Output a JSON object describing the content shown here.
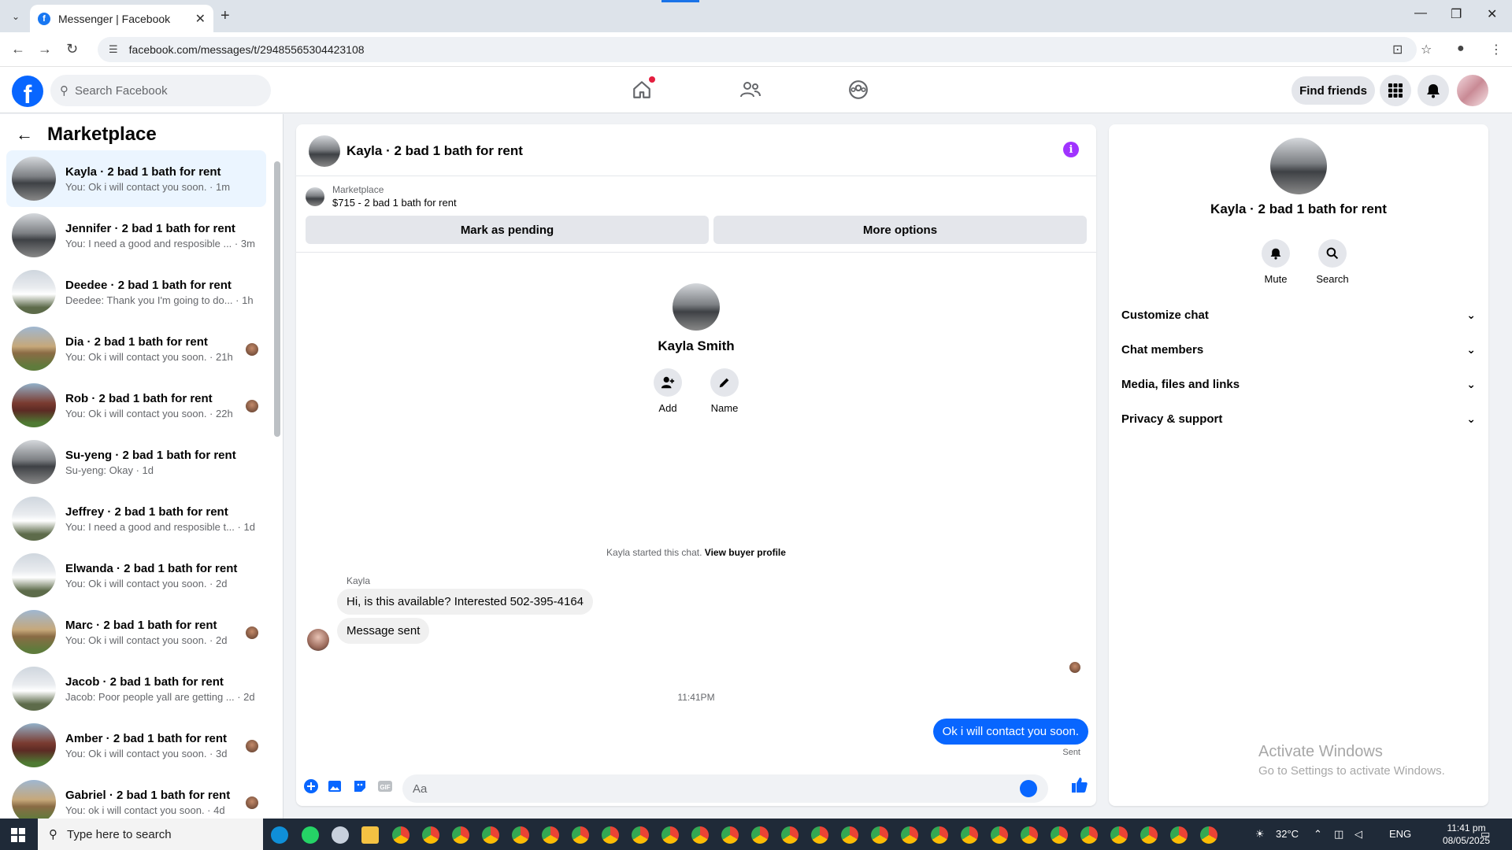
{
  "browser": {
    "tab_title": "Messenger | Facebook",
    "url": "facebook.com/messages/t/29485565304423108"
  },
  "fb_header": {
    "search_placeholder": "Search Facebook",
    "find_friends_label": "Find friends"
  },
  "left_panel": {
    "title": "Marketplace",
    "conversations": [
      {
        "name": "Kayla · 2 bad 1 bath for rent",
        "snippet": "You: Ok i will contact you soon. · 1m",
        "thumb": "house-dark",
        "active": true,
        "seen": false
      },
      {
        "name": "Jennifer · 2 bad 1 bath for rent",
        "snippet": "You: I need a good and resposible ... · 3m",
        "thumb": "house-dark",
        "active": false,
        "seen": false
      },
      {
        "name": "Deedee · 2 bad 1 bath for rent",
        "snippet": "Deedee: Thank you I'm going to do... · 1h",
        "thumb": "house-white",
        "active": false,
        "seen": false
      },
      {
        "name": "Dia · 2 bad 1 bath for rent",
        "snippet": "You: Ok i will contact you soon. · 21h",
        "thumb": "house-tan",
        "active": false,
        "seen": true
      },
      {
        "name": "Rob · 2 bad 1 bath for rent",
        "snippet": "You: Ok i will contact you soon. · 22h",
        "thumb": "house-red",
        "active": false,
        "seen": true
      },
      {
        "name": "Su-yeng · 2 bad 1 bath for rent",
        "snippet": "Su-yeng: Okay · 1d",
        "thumb": "house-dark",
        "active": false,
        "seen": false
      },
      {
        "name": "Jeffrey · 2 bad 1 bath for rent",
        "snippet": "You: I need a good and resposible t... · 1d",
        "thumb": "house-white",
        "active": false,
        "seen": false
      },
      {
        "name": "Elwanda · 2 bad 1 bath for rent",
        "snippet": "You: Ok i will contact you soon. · 2d",
        "thumb": "house-white",
        "active": false,
        "seen": false
      },
      {
        "name": "Marc · 2 bad 1 bath for rent",
        "snippet": "You: Ok i will contact you soon. · 2d",
        "thumb": "house-tan",
        "active": false,
        "seen": true
      },
      {
        "name": "Jacob · 2 bad 1 bath for rent",
        "snippet": "Jacob: Poor people yall are getting ... · 2d",
        "thumb": "house-white",
        "active": false,
        "seen": false
      },
      {
        "name": "Amber · 2 bad 1 bath for rent",
        "snippet": "You: Ok i will contact you soon. · 3d",
        "thumb": "house-red",
        "active": false,
        "seen": true
      },
      {
        "name": "Gabriel · 2 bad 1 bath for rent",
        "snippet": "You: ok i will contact you soon. · 4d",
        "thumb": "house-tan",
        "active": false,
        "seen": true
      }
    ]
  },
  "chat": {
    "title": "Kayla · 2 bad 1 bath for rent",
    "marketplace_label": "Marketplace",
    "listing": "$715 - 2 bad 1 bath for rent",
    "mark_pending_label": "Mark as pending",
    "more_options_label": "More options",
    "profile_name": "Kayla Smith",
    "add_label": "Add",
    "name_label": "Name",
    "started_text": "Kayla started this chat.",
    "view_buyer_label": "View buyer profile",
    "sender_name": "Kayla",
    "msg1": "Hi, is this available? Interested  502-395-4164",
    "msg2": "Message sent",
    "timestamp": "11:41PM",
    "msg_out": "Ok i will contact you soon.",
    "sent_label": "Sent",
    "composer_placeholder": "Aa"
  },
  "right_panel": {
    "name": "Kayla · 2 bad 1 bath for rent",
    "mute_label": "Mute",
    "search_label": "Search",
    "sections": [
      "Customize chat",
      "Chat members",
      "Media, files and links",
      "Privacy & support"
    ],
    "watermark_title": "Activate Windows",
    "watermark_sub": "Go to Settings to activate Windows."
  },
  "taskbar": {
    "search_placeholder": "Type here to search",
    "temperature": "32°C",
    "language": "ENG",
    "time": "11:41 pm",
    "date": "08/05/2025"
  }
}
